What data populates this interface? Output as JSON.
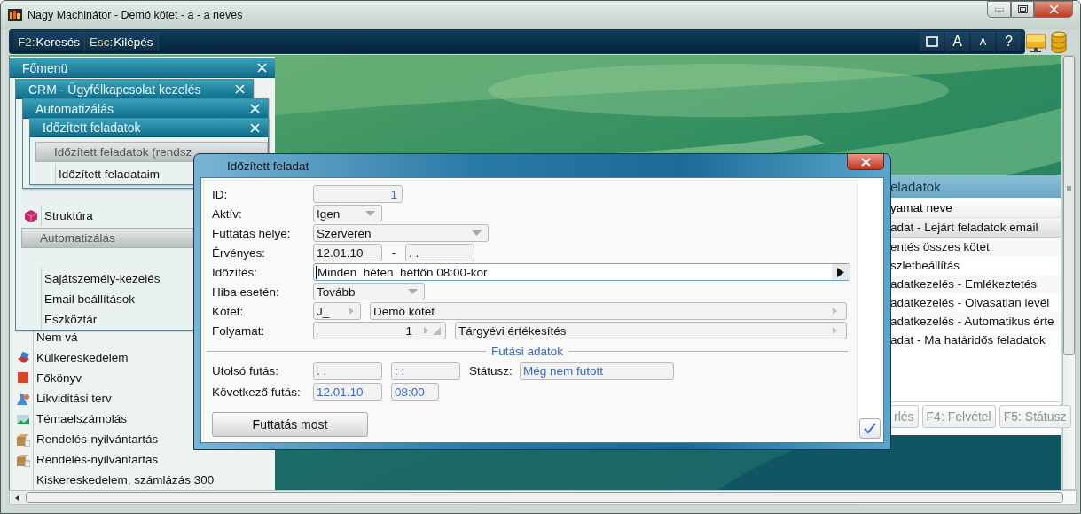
{
  "window": {
    "title": "Nagy Machinátor - Demó kötet - a - a neves"
  },
  "toolbar": {
    "commands": [
      {
        "key": "F2:",
        "label": "Keresés"
      },
      {
        "key": "Esc:",
        "label": "Kilépés"
      }
    ],
    "tools": [
      {
        "kind": "square"
      },
      {
        "kind": "large",
        "label": "A"
      },
      {
        "kind": "small",
        "label": "A"
      },
      {
        "kind": "large",
        "label": "?"
      }
    ]
  },
  "main_menu": {
    "title": "Főmenü",
    "items": [
      {
        "label": "Nem vá",
        "kind": "plain"
      },
      {
        "label": "Külkereskedelem",
        "kind": "icon"
      },
      {
        "label": "Főkönyv",
        "kind": "icon"
      },
      {
        "label": "Likviditási terv",
        "kind": "icon"
      },
      {
        "label": "Témaelszámolás",
        "kind": "icon"
      },
      {
        "label": "Rendelés-nyilvántartás",
        "kind": "icon"
      },
      {
        "label": "Rendelés-nyilvántartás",
        "kind": "icon"
      },
      {
        "label": "Kiskereskedelem, számlázás 300",
        "kind": "plain"
      }
    ]
  },
  "submenus": [
    {
      "title": "CRM - Ügyfélkapcsolat kezelés",
      "items": [
        {
          "label": "Struktúra",
          "kind": "icon"
        },
        {
          "label": "Automatizálás",
          "kind": "header"
        },
        {
          "label": "Sajátszemély-kezelés",
          "kind": "plain"
        },
        {
          "label": "Email beállítások",
          "kind": "plain"
        },
        {
          "label": "Eszköztár",
          "kind": "plain"
        }
      ]
    },
    {
      "title": "Automatizálás"
    },
    {
      "title": "Időzített feladatok",
      "items": [
        {
          "label": "Időzített feladatok (rendsz",
          "kind": "header"
        },
        {
          "label": "Időzített feladataim",
          "kind": "plain"
        }
      ]
    }
  ],
  "list_window": {
    "title": "eladatok",
    "column": "yamat neve",
    "rows": [
      {
        "label": "adat - Lejárt feladatok email",
        "selected": true
      },
      {
        "label": "entés összes kötet",
        "selected": false
      },
      {
        "label": "szletbeállítás",
        "selected": false
      },
      {
        "label": "adatkezelés - Emlékeztetés",
        "selected": false
      },
      {
        "label": "adatkezelés - Olvasatlan levél",
        "selected": false
      },
      {
        "label": "adatkezelés - Automatikus érte",
        "selected": false
      },
      {
        "label": "adat - Ma határidős feladatok",
        "selected": false
      }
    ],
    "buttons": [
      {
        "label": "rlés",
        "disabled": true
      },
      {
        "label": "F4: Felvétel",
        "disabled": true
      },
      {
        "label": "F5: Státusz",
        "disabled": true
      }
    ]
  },
  "dialog": {
    "title": "Időzített feladat",
    "fields": [
      {
        "kind": "number",
        "label": "ID:",
        "value": "1",
        "focused": false
      },
      {
        "kind": "dropdown",
        "label": "Aktív:",
        "value": "Igen",
        "focused": false
      },
      {
        "kind": "dropdown",
        "label": "Futtatás helye:",
        "value": "Szerveren",
        "focused": false
      },
      {
        "kind": "range",
        "label": "Érvényes:",
        "from": "12.01.10",
        "separator": "-",
        "to": ". .",
        "focused": false
      },
      {
        "kind": "picker",
        "label": "Időzítés:",
        "value": "Minden  héten  hétfőn 08:00-kor",
        "focused": true
      },
      {
        "kind": "dropdown",
        "label": "Hiba esetén:",
        "value": "Tovább",
        "focused": false
      },
      {
        "kind": "lookup",
        "label": "Kötet:",
        "code": "J_",
        "value": "Demó kötet",
        "focused": false
      },
      {
        "kind": "lookup",
        "label": "Folyamat:",
        "code": "1",
        "value": "Tárgyévi értékesítés",
        "focused": false
      }
    ],
    "section": "Futási adatok",
    "run_rows": [
      {
        "label": "Utolsó futás:",
        "date": ". .",
        "time": ": :",
        "status_label": "Státusz:",
        "status": "Még nem futott"
      },
      {
        "label": "Következő futás:",
        "date": "12.01.10",
        "time": "08:00"
      }
    ],
    "run_button": "Futtatás most"
  }
}
